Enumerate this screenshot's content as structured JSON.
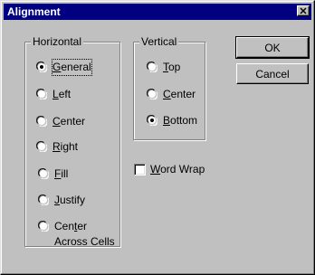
{
  "window": {
    "title": "Alignment",
    "close_label": "✕"
  },
  "horizontal": {
    "label": "Horizontal",
    "options": [
      {
        "label": "General",
        "mnemonic_index": 0,
        "selected": true
      },
      {
        "label": "Left",
        "mnemonic_index": 0,
        "selected": false
      },
      {
        "label": "Center",
        "mnemonic_index": 0,
        "selected": false
      },
      {
        "label": "Right",
        "mnemonic_index": 0,
        "selected": false
      },
      {
        "label": "Fill",
        "mnemonic_index": 0,
        "selected": false
      },
      {
        "label": "Justify",
        "mnemonic_index": 0,
        "selected": false
      },
      {
        "label": "Center",
        "mnemonic_index": 3,
        "selected": false
      }
    ],
    "center_across_line2": "Across Cells"
  },
  "vertical": {
    "label": "Vertical",
    "options": [
      {
        "label": "Top",
        "mnemonic_index": 0,
        "selected": false
      },
      {
        "label": "Center",
        "mnemonic_index": 0,
        "selected": false
      },
      {
        "label": "Bottom",
        "mnemonic_index": 0,
        "selected": true
      }
    ]
  },
  "word_wrap": {
    "label": "Word Wrap",
    "mnemonic_index": 0,
    "checked": false
  },
  "buttons": {
    "ok": "OK",
    "cancel": "Cancel"
  }
}
